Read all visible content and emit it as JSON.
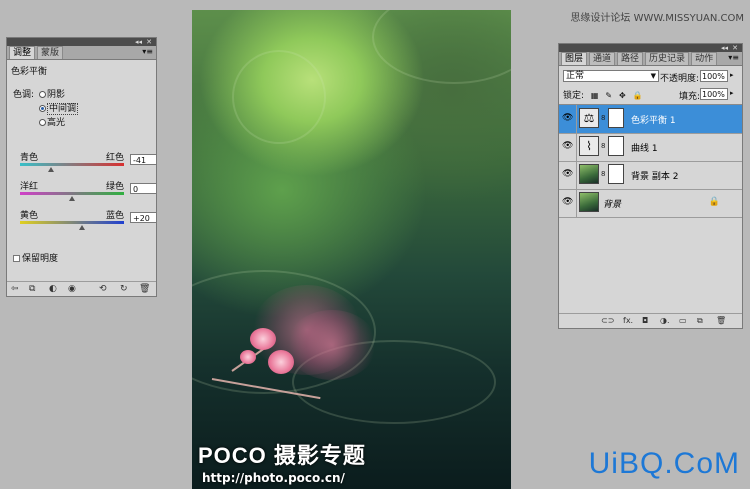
{
  "watermark_top": "思缘设计论坛 WWW.MISSYUAN.COM",
  "watermark_bottom": "UiBQ.CoM",
  "photo": {
    "brand": "POCO 摄影专题",
    "url": "http://photo.poco.cn/"
  },
  "adjustments": {
    "tabs": [
      {
        "label": "调整",
        "active": true
      },
      {
        "label": "蒙版",
        "active": false
      }
    ],
    "title": "色彩平衡",
    "tone_label": "色调:",
    "tones": [
      {
        "label": "阴影",
        "selected": false
      },
      {
        "label": "中间调",
        "selected": true
      },
      {
        "label": "高光",
        "selected": false
      }
    ],
    "sliders": [
      {
        "left": "青色",
        "right": "红色",
        "value": "-41",
        "level": -41,
        "colors": [
          "#38c0c8",
          "#d83030"
        ]
      },
      {
        "left": "洋红",
        "right": "绿色",
        "value": "0",
        "level": 0,
        "colors": [
          "#d040c8",
          "#30b040"
        ]
      },
      {
        "left": "黄色",
        "right": "蓝色",
        "value": "+20",
        "level": 20,
        "colors": [
          "#e0d020",
          "#2040d0"
        ]
      }
    ],
    "preserve_luminosity": {
      "label": "保留明度",
      "checked": false
    }
  },
  "layers": {
    "tabs": [
      {
        "label": "图层",
        "active": true
      },
      {
        "label": "通道",
        "active": false
      },
      {
        "label": "路径",
        "active": false
      },
      {
        "label": "历史记录",
        "active": false
      },
      {
        "label": "动作",
        "active": false
      }
    ],
    "blend_mode": "正常",
    "opacity_label": "不透明度:",
    "opacity": "100%",
    "lock_label": "锁定:",
    "fill_label": "填充:",
    "fill": "100%",
    "items": [
      {
        "name": "色彩平衡 1",
        "thumb": "scale-icon",
        "selected": true,
        "mask": true
      },
      {
        "name": "曲线 1",
        "thumb": "curves-icon",
        "selected": false,
        "mask": true
      },
      {
        "name": "背景 副本 2",
        "thumb": "photo",
        "selected": false,
        "mask": true
      },
      {
        "name": "背景",
        "thumb": "photo",
        "selected": false,
        "mask": false,
        "locked": true
      }
    ]
  }
}
